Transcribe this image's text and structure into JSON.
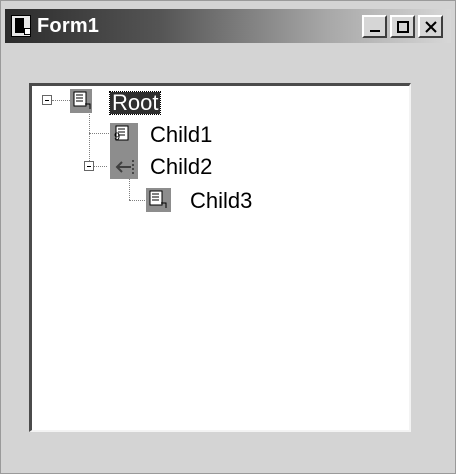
{
  "window": {
    "title": "Form1"
  },
  "title_buttons": [
    {
      "name": "minimize"
    },
    {
      "name": "maximize"
    },
    {
      "name": "close"
    }
  ],
  "tree": {
    "root": {
      "label": "Root",
      "expanded": true,
      "selected": true,
      "children": [
        {
          "label": "Child1",
          "expanded": false
        },
        {
          "label": "Child2",
          "expanded": true,
          "children": [
            {
              "label": "Child3"
            }
          ]
        }
      ]
    }
  }
}
